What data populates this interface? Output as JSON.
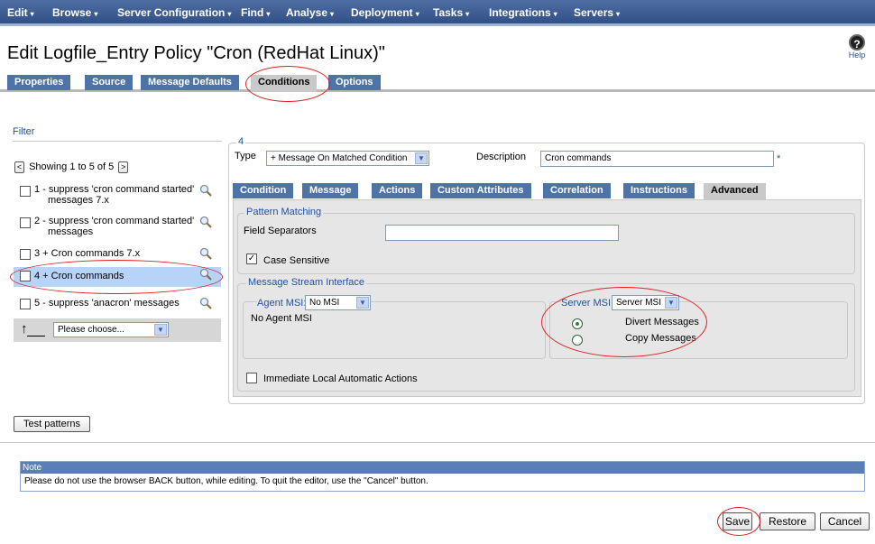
{
  "menu": [
    {
      "label": "Edit",
      "caret": "▾"
    },
    {
      "label": "Browse",
      "caret": "▾"
    },
    {
      "label": "Server Configuration",
      "caret": "▾"
    },
    {
      "label": "Find",
      "caret": "▾"
    },
    {
      "label": "Analyse",
      "caret": "▾"
    },
    {
      "label": "Deployment",
      "caret": "▾"
    },
    {
      "label": "Tasks",
      "caret": "▾"
    },
    {
      "label": "Integrations",
      "caret": "▾"
    },
    {
      "label": "Servers",
      "caret": "▾"
    }
  ],
  "page": {
    "title": "Edit Logfile_Entry Policy \"Cron (RedHat Linux)\"",
    "help_label": "Help",
    "help_glyph": "?"
  },
  "tabs": [
    "Properties",
    "Source",
    "Message Defaults",
    "Conditions",
    "Options"
  ],
  "active_tab": "Conditions",
  "filter": {
    "label": "Filter",
    "showing": "Showing 1 to 5 of 5",
    "prev": "<",
    "next": ">",
    "items": [
      {
        "line1": "1 - suppress 'cron command started'",
        "line2": "messages 7.x"
      },
      {
        "line1": "2 - suppress 'cron command started'",
        "line2": "messages"
      },
      {
        "line1": "3 + Cron commands 7.x",
        "line2": ""
      },
      {
        "line1": "4 + Cron commands",
        "line2": ""
      },
      {
        "line1": "5 - suppress 'anacron' messages",
        "line2": ""
      }
    ],
    "selected_index": 3,
    "move_select": "Please choose...",
    "move_icon": "↑"
  },
  "condition": {
    "number": "4",
    "type_label": "Type",
    "type_value": "+ Message On Matched Condition",
    "description_label": "Description",
    "description_value": "Cron commands",
    "required_mark": "*"
  },
  "subtabs": [
    "Condition",
    "Message",
    "Actions",
    "Custom Attributes",
    "Correlation",
    "Instructions",
    "Advanced"
  ],
  "active_subtab": "Advanced",
  "advanced": {
    "pattern_matching": "Pattern Matching",
    "field_separators": "Field Separators",
    "field_separators_value": "",
    "case_sensitive": "Case Sensitive",
    "case_sensitive_checked": true,
    "msi": "Message Stream Interface",
    "agent_msi_label": "Agent MSI:",
    "agent_msi_value": "No MSI",
    "agent_msi_text": "No Agent MSI",
    "server_msi_label": "Server MSI:",
    "server_msi_value": "Server MSI",
    "divert": "Divert Messages",
    "copy": "Copy Messages",
    "divert_selected": true,
    "immediate": "Immediate Local Automatic Actions",
    "immediate_checked": false
  },
  "test_patterns": "Test patterns",
  "note": {
    "title": "Note",
    "text": "Please do not use the browser BACK button, while editing. To quit the editor, use the \"Cancel\" button."
  },
  "buttons": {
    "save": "Save",
    "restore": "Restore",
    "cancel": "Cancel"
  },
  "colors": {
    "menubar": "#2f4f86",
    "tab": "#4d73a8",
    "active_tab": "#c9c9c9",
    "highlight": "#b7d3f7",
    "annotation": "#dd2222"
  }
}
